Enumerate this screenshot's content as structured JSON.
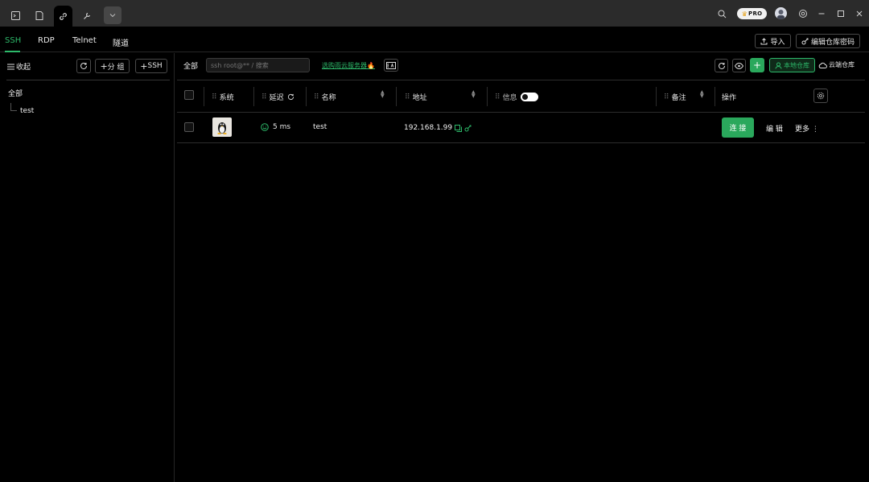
{
  "titlebar": {
    "tabs": [
      {
        "icon": "terminal-icon"
      },
      {
        "icon": "document-icon"
      },
      {
        "icon": "link-icon",
        "active": true
      },
      {
        "icon": "wrench-icon"
      },
      {
        "icon": "chevron-down-icon"
      }
    ],
    "pro_badge": "PRO"
  },
  "protocol_tabs": [
    "SSH",
    "RDP",
    "Telnet",
    "隧道"
  ],
  "header_actions": {
    "import_label": "导入",
    "edit_password_label": "编辑仓库密码"
  },
  "sidebar": {
    "collapse_label": "收起",
    "add_group_label": "分 组",
    "add_ssh_label": "SSH",
    "all_label": "全部",
    "groups": [
      "test"
    ]
  },
  "toolbar": {
    "all_label": "全部",
    "search_placeholder": "ssh root@** / 搜索",
    "promo_text": "选购雨云服务器",
    "local_repo_label": "本地仓库",
    "cloud_repo_label": "云端仓库"
  },
  "table": {
    "columns": {
      "system": "系统",
      "latency": "延迟",
      "name": "名称",
      "address": "地址",
      "info": "信息",
      "note": "备注",
      "actions": "操作"
    },
    "rows": [
      {
        "os": "linux",
        "latency": "5 ms",
        "name": "test",
        "address": "192.168.1.99",
        "connect_label": "连 接",
        "edit_label": "编 辑",
        "more_label": "更多"
      }
    ]
  },
  "colors": {
    "accent": "#2db96a",
    "button_green": "#2aa85c",
    "background": "#000000",
    "titlebar": "#2b2b2b"
  }
}
